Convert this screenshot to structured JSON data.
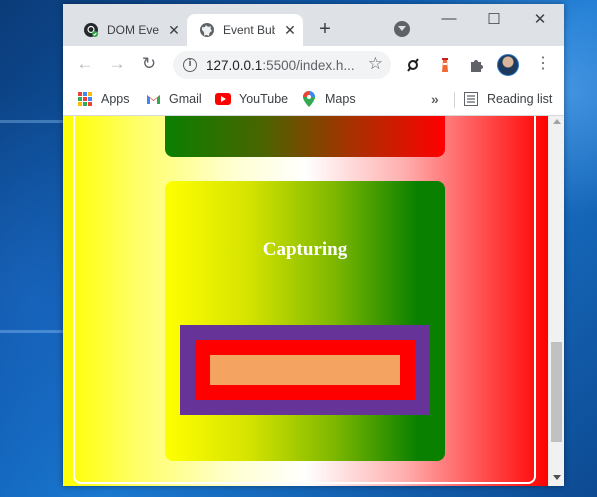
{
  "colors": {
    "page_gradient": [
      "#ffff00",
      "#ffffff",
      "#ff0000"
    ],
    "capture_gradient": [
      "#ffff00",
      "#0a8000"
    ],
    "purple_box": "#663399",
    "red_box": "#ff0000",
    "orange_box": "#f4a460"
  },
  "tabs": [
    {
      "title": "DOM Event",
      "icon": "github-icon",
      "close": "✕"
    },
    {
      "title": "Event Bubl",
      "icon": "globe-icon",
      "close": "✕",
      "active": true
    }
  ],
  "tabstrip": {
    "new_tab": "+",
    "minimize": "—",
    "maximize": "☐",
    "close": "✕"
  },
  "toolbar": {
    "back": "←",
    "forward": "→",
    "reload": "↻",
    "info": "i",
    "url_host": "127.0.0.1",
    "url_rest": ":5500/index.h...",
    "star": "☆",
    "menu": "⋮"
  },
  "bookmarks": {
    "items": [
      {
        "label": "Apps",
        "icon": "apps-grid-icon"
      },
      {
        "label": "Gmail",
        "icon": "gmail-icon"
      },
      {
        "label": "YouTube",
        "icon": "youtube-icon"
      },
      {
        "label": "Maps",
        "icon": "maps-icon"
      }
    ],
    "overflow": "»",
    "reading_list": "Reading list"
  },
  "page": {
    "capture_heading": "Capturing"
  }
}
